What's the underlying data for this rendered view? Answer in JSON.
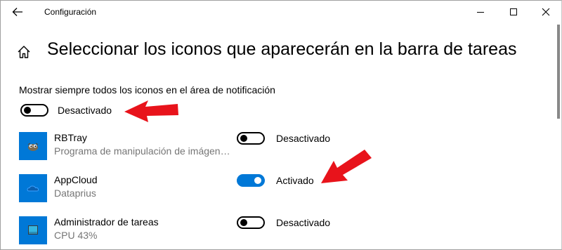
{
  "window": {
    "title": "Configuración"
  },
  "page": {
    "title": "Seleccionar los iconos que aparecerán en la barra de tareas"
  },
  "always_show": {
    "label": "Mostrar siempre todos los iconos en el área de notificación",
    "state_text": "Desactivado",
    "on": false
  },
  "apps": [
    {
      "name": "RBTray",
      "description": "Programa de manipulación de imágenes GNU",
      "state_text": "Desactivado",
      "on": false,
      "icon": "gimp-wilber-icon"
    },
    {
      "name": "AppCloud",
      "description": "Dataprius",
      "state_text": "Activado",
      "on": true,
      "icon": "cloud-icon"
    },
    {
      "name": "Administrador de tareas",
      "description": "CPU 43%",
      "state_text": "Desactivado",
      "on": false,
      "icon": "task-manager-icon"
    }
  ],
  "colors": {
    "accent": "#0078d7",
    "annotation_arrow": "#e8131b",
    "secondary_text": "#767676"
  }
}
